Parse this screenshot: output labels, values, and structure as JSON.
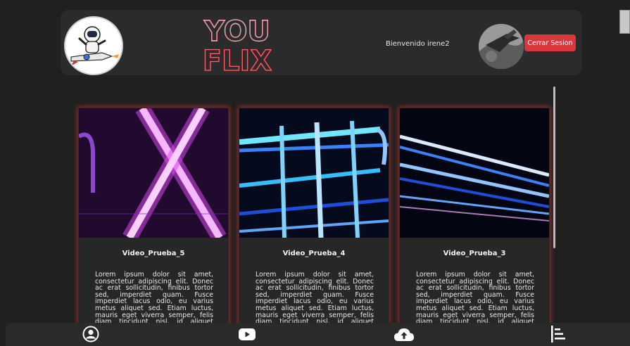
{
  "header": {
    "welcome_text": "Bienvenido irene2",
    "logout_label": "Cerrar Sesion",
    "brand_line1": "YOU",
    "brand_line2": "FLIX"
  },
  "videos": [
    {
      "title": "Video_Prueba_5",
      "description": "Lorem ipsum dolor sit amet, consectetur adipiscing elit. Donec ac erat sollicitudin, finibus tortor sed, imperdiet quam. Fusce imperdiet lacus odio, eu varius metus aliquet sed. Etiam luctus, mauris eget viverra semper, felis diam tincidunt nisl, id aliquet augue"
    },
    {
      "title": "Video_Prueba_4",
      "description": "Lorem ipsum dolor sit amet, consectetur adipiscing elit. Donec ac erat sollicitudin, finibus tortor sed, imperdiet quam. Fusce imperdiet lacus odio, eu varius metus aliquet sed. Etiam luctus, mauris eget viverra semper, felis diam tincidunt nisl, id aliquet augue"
    },
    {
      "title": "Video_Prueba_3",
      "description": "Lorem ipsum dolor sit amet, consectetur adipiscing elit. Donec ac erat sollicitudin, finibus tortor sed, imperdiet quam. Fusce imperdiet lacus odio, eu varius metus aliquet sed. Etiam luctus, mauris eget viverra semper, felis diam tincidunt nisl, id aliquet augue"
    }
  ],
  "nav": {
    "items": [
      "profile-icon",
      "youtube-icon",
      "upload-cloud-icon",
      "list-menu-icon"
    ]
  },
  "colors": {
    "background": "#202020",
    "panel": "#2b2b2b",
    "accent_red": "#d9363e",
    "neon_magenta": "#e040fb",
    "neon_cyan": "#6ee7ff"
  }
}
